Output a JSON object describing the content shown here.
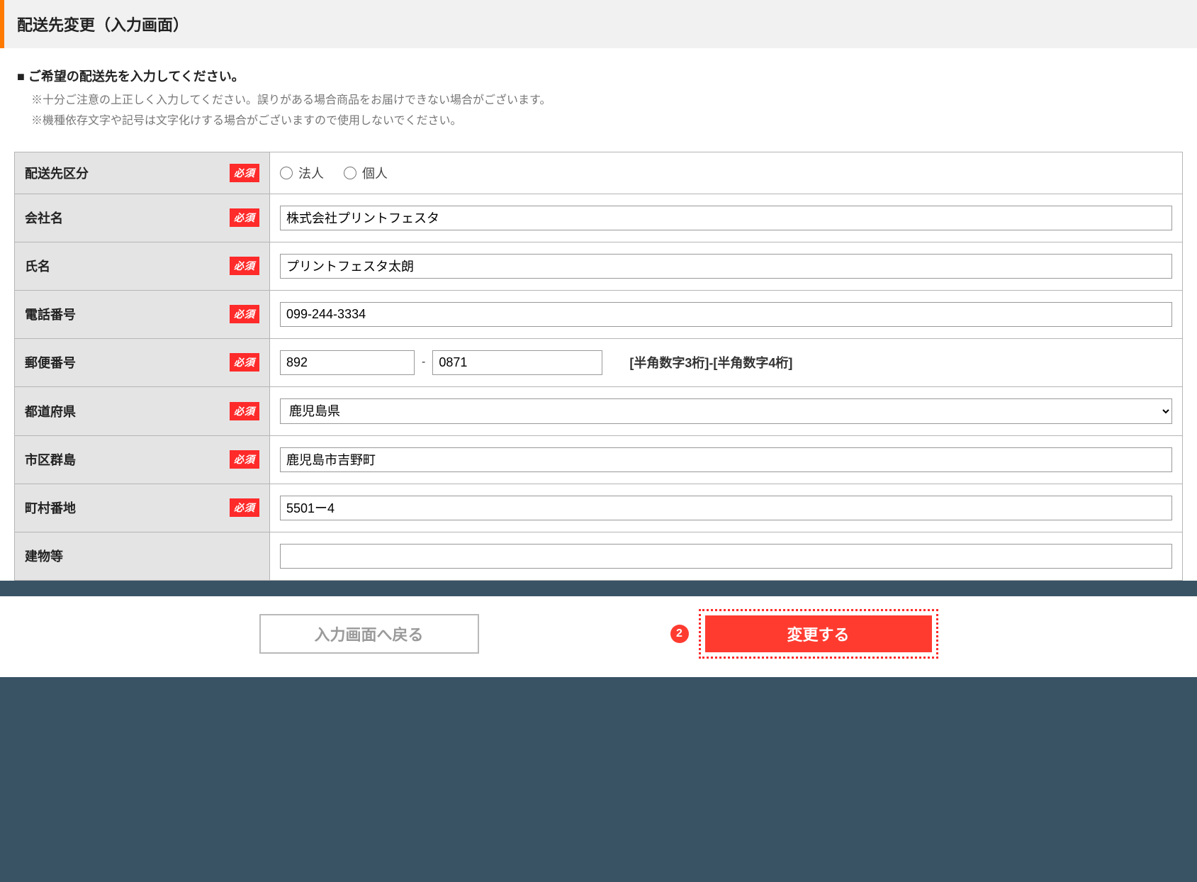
{
  "page": {
    "title": "配送先変更（入力画面）",
    "intro_heading": "■ ご希望の配送先を入力してください。",
    "intro_note1": "※十分ご注意の上正しく入力してください。誤りがある場合商品をお届けできない場合がございます。",
    "intro_note2": "※機種依存文字や記号は文字化けする場合がございますので使用しないでください。"
  },
  "labels": {
    "required": "必須",
    "category": "配送先区分",
    "company": "会社名",
    "name": "氏名",
    "phone": "電話番号",
    "postal": "郵便番号",
    "prefecture": "都道府県",
    "city": "市区群島",
    "street": "町村番地",
    "building": "建物等",
    "radio_corp": "法人",
    "radio_indiv": "個人",
    "postal_hint": "[半角数字3桁]-[半角数字4桁]",
    "dash": "-"
  },
  "values": {
    "company": "株式会社プリントフェスタ",
    "name": "プリントフェスタ太朗",
    "phone": "099-244-3334",
    "postal1": "892",
    "postal2": "0871",
    "prefecture": "鹿児島県",
    "city": "鹿児島市吉野町",
    "street": "5501ー4",
    "building": ""
  },
  "buttons": {
    "back": "入力画面へ戻る",
    "submit": "変更する",
    "step_number": "2"
  }
}
